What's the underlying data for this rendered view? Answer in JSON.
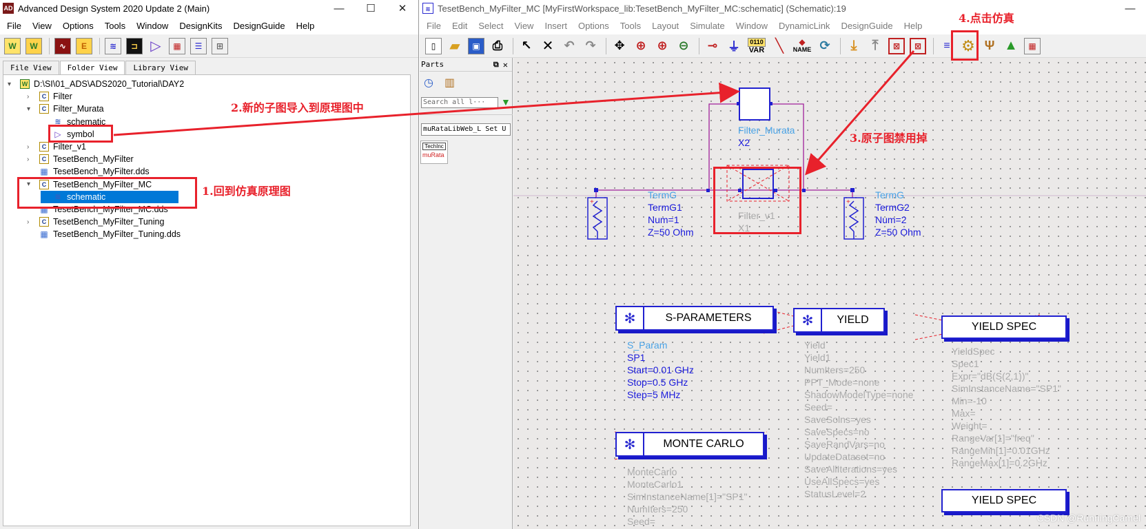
{
  "main_window": {
    "title": "Advanced Design System 2020 Update 2 (Main)",
    "app_icon_text": "AD",
    "controls": [
      "—",
      "☐",
      "✕"
    ],
    "menu": [
      "File",
      "View",
      "Options",
      "Tools",
      "Window",
      "DesignKits",
      "DesignGuide",
      "Help"
    ],
    "tabs": [
      "File View",
      "Folder View",
      "Library View"
    ],
    "active_tab": "Folder View",
    "tree": [
      {
        "label": "D:\\SI\\01_ADS\\ADS2020_Tutorial\\DAY2",
        "icon": "workspace-icon",
        "expander": "▾"
      },
      {
        "label": "Filter",
        "icon": "cell-icon",
        "expander": "›"
      },
      {
        "label": "Filter_Murata",
        "icon": "cell-icon",
        "expander": "▾"
      },
      {
        "label": "schematic",
        "icon": "schematic-icon",
        "expander": ""
      },
      {
        "label": "symbol",
        "icon": "symbol-icon",
        "expander": ""
      },
      {
        "label": "Filter_v1",
        "icon": "cell-icon",
        "expander": "›"
      },
      {
        "label": "TesetBench_MyFilter",
        "icon": "cell-icon",
        "expander": "›"
      },
      {
        "label": "TesetBench_MyFilter.dds",
        "icon": "dds-icon",
        "expander": ""
      },
      {
        "label": "TesetBench_MyFilter_MC",
        "icon": "cell-icon",
        "expander": "▾"
      },
      {
        "label": "schematic",
        "icon": "schematic-icon",
        "expander": ""
      },
      {
        "label": "TesetBench_MyFilter_MC.dds",
        "icon": "dds-icon",
        "expander": ""
      },
      {
        "label": "TesetBench_MyFilter_Tuning",
        "icon": "cell-icon",
        "expander": "›"
      },
      {
        "label": "TesetBench_MyFilter_Tuning.dds",
        "icon": "dds-icon",
        "expander": ""
      }
    ]
  },
  "schematic_window": {
    "title": "TesetBench_MyFilter_MC [MyFirstWorkspace_lib:TesetBench_MyFilter_MC:schematic] (Schematic):19",
    "controls": [
      "—"
    ],
    "menu": [
      "File",
      "Edit",
      "Select",
      "View",
      "Insert",
      "Options",
      "Tools",
      "Layout",
      "Simulate",
      "Window",
      "DynamicLink",
      "DesignGuide",
      "Help"
    ],
    "toolbar_var_label": "VAR",
    "toolbar_var_top": "0110",
    "toolbar_name_label": "NAME",
    "parts_panel": {
      "title": "Parts",
      "search_placeholder": "Search all l···",
      "library": "muRataLibWeb_L Set U",
      "palette": [
        "TechInc",
        "muRata"
      ]
    }
  },
  "annotations": {
    "a1": "1.回到仿真原理图",
    "a2": "2.新的子图导入到原理图中",
    "a3": "3.原子图禁用掉",
    "a4": "4.点击仿真"
  },
  "schematic": {
    "sub_new": {
      "type": "Filter_Murata",
      "name": "X2"
    },
    "sub_old": {
      "type": "Filter_v1",
      "name": "X1"
    },
    "term1": {
      "type": "TermG",
      "name": "TermG1",
      "num": "Num=1",
      "z": "Z=50 Ohm"
    },
    "term2": {
      "type": "TermG",
      "name": "TermG2",
      "num": "Num=2",
      "z": "Z=50 Ohm"
    },
    "sparam": {
      "box": "S-PARAMETERS",
      "type": "S_Param",
      "name": "SP1",
      "lines": [
        "Start=0.01 GHz",
        "Stop=0.5 GHz",
        "Step=5 MHz"
      ]
    },
    "yield": {
      "box": "YIELD",
      "type": "Yield",
      "name": "Yield1",
      "lines": [
        "NumIters=250",
        "PPT_Mode=none",
        "ShadowModelType=none",
        "Seed=",
        "SaveSolns=yes",
        "SaveSpecs=no",
        "SaveRandVars=no",
        "UpdateDataset=no",
        "SaveAllIterations=yes",
        "UseAllSpecs=yes",
        "StatusLevel=2"
      ]
    },
    "yieldspec1": {
      "box": "YIELD SPEC",
      "type": "YieldSpec",
      "name": "Spec1",
      "lines": [
        "Expr=\"dB(S(2,1))\"",
        "SimInstanceName=\"SP1\"",
        "Min=-10",
        "Max=",
        "Weight=",
        "RangeVar[1]=\"freq\"",
        "RangeMin[1]=0.01GHz",
        "RangeMax[1]=0.2GHz"
      ]
    },
    "montecarlo": {
      "box": "MONTE CARLO",
      "type": "MonteCarlo",
      "name": "MonteCarlo1",
      "lines": [
        "SimInstanceName[1]=\"SP1\"",
        "NumIters=250",
        "Seed="
      ]
    },
    "yieldspec2": {
      "box": "YIELD SPEC"
    }
  },
  "watermark": "CSDN @RunningCamel",
  "colors": {
    "annotation_red": "#e8212b",
    "component_blue": "#1a1adb",
    "label_cyan": "#4aa3e6",
    "disabled_grey": "#aaaaaa",
    "selection": "#0078d7",
    "wire": "#a0209a"
  }
}
